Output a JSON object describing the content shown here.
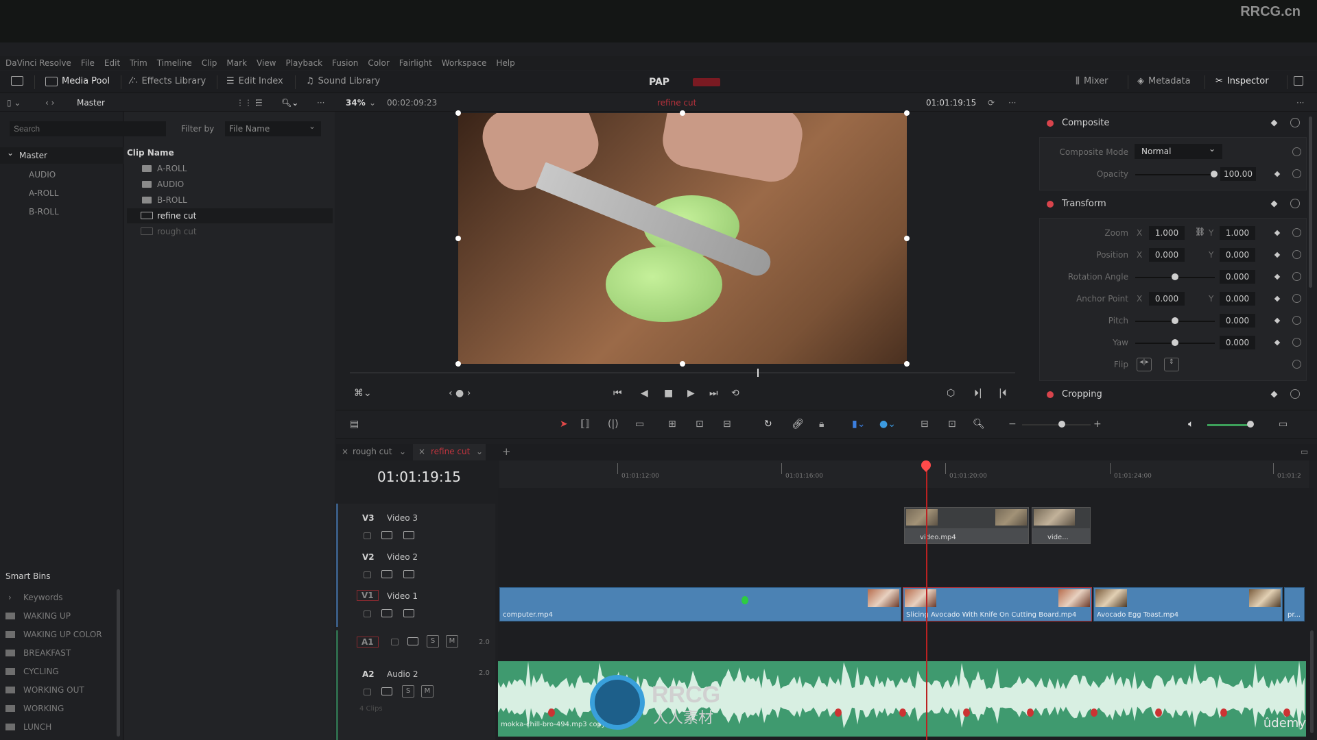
{
  "watermark": {
    "site": "RRCG.cn",
    "logo_text": "RRCG",
    "logo_sub": "人人素材",
    "brand": "ûdemy"
  },
  "menu": [
    "DaVinci Resolve",
    "File",
    "Edit",
    "Trim",
    "Timeline",
    "Clip",
    "Mark",
    "View",
    "Playback",
    "Fusion",
    "Color",
    "Fairlight",
    "Workspace",
    "Help"
  ],
  "modebar": {
    "left": [
      {
        "label": "Media Pool",
        "icon": "media-pool-icon"
      },
      {
        "label": "Effects Library",
        "icon": "effects-icon"
      },
      {
        "label": "Edit Index",
        "icon": "list-icon"
      },
      {
        "label": "Sound Library",
        "icon": "music-icon"
      }
    ],
    "project_title": "PAP",
    "right": [
      {
        "label": "Mixer",
        "icon": "mixer-icon"
      },
      {
        "label": "Metadata",
        "icon": "metadata-icon"
      },
      {
        "label": "Inspector",
        "icon": "inspector-icon"
      }
    ]
  },
  "viewer_bar": {
    "bin_path": "Master",
    "zoom": "34%",
    "duration": "00:02:09:23",
    "timeline_name": "refine cut",
    "timecode": "01:01:19:15"
  },
  "media_pool": {
    "search_placeholder": "Search",
    "filter_label": "Filter by",
    "filter_value": "File Name",
    "bins": {
      "master": "Master",
      "children": [
        "AUDIO",
        "A-ROLL",
        "B-ROLL"
      ]
    },
    "clip_header": "Clip Name",
    "clips": [
      {
        "name": "A-ROLL",
        "type": "folder"
      },
      {
        "name": "AUDIO",
        "type": "folder"
      },
      {
        "name": "B-ROLL",
        "type": "folder"
      },
      {
        "name": "refine cut",
        "type": "timeline",
        "selected": true
      },
      {
        "name": "rough cut",
        "type": "timeline"
      }
    ],
    "smart_bins_label": "Smart Bins",
    "smart_bins": [
      "Keywords",
      "WAKING UP",
      "WAKING UP COLOR",
      "BREAKFAST",
      "CYCLING",
      "WORKING OUT",
      "WORKING",
      "LUNCH"
    ]
  },
  "inspector": {
    "composite": {
      "title": "Composite",
      "mode_label": "Composite Mode",
      "mode_value": "Normal",
      "opacity_label": "Opacity",
      "opacity_value": "100.00"
    },
    "transform": {
      "title": "Transform",
      "zoom_label": "Zoom",
      "zoom_x": "1.000",
      "zoom_y": "1.000",
      "position_label": "Position",
      "position_x": "0.000",
      "position_y": "0.000",
      "rotation_label": "Rotation Angle",
      "rotation_value": "0.000",
      "anchor_label": "Anchor Point",
      "anchor_x": "0.000",
      "anchor_y": "0.000",
      "pitch_label": "Pitch",
      "pitch_value": "0.000",
      "yaw_label": "Yaw",
      "yaw_value": "0.000",
      "flip_label": "Flip",
      "x": "X",
      "y": "Y"
    },
    "cropping": {
      "title": "Cropping"
    }
  },
  "timeline": {
    "tabs": [
      {
        "label": "rough cut"
      },
      {
        "label": "refine cut",
        "active": true
      }
    ],
    "timecode": "01:01:19:15",
    "ruler": [
      "01:01:12:00",
      "01:01:16:00",
      "01:01:20:00",
      "01:01:24:00",
      "01:01:2"
    ],
    "tracks": {
      "v3": {
        "id": "V3",
        "name": "Video 3"
      },
      "v2": {
        "id": "V2",
        "name": "Video 2"
      },
      "v1": {
        "id": "V1",
        "name": "Video 1"
      },
      "a1": {
        "id": "A1",
        "channels": "2.0"
      },
      "a2": {
        "id": "A2",
        "name": "Audio 2",
        "channels": "2.0",
        "clips": "4 Clips"
      }
    },
    "v3_clips": [
      "video.mp4",
      "vide..."
    ],
    "v1_clips": [
      "computer.mp4",
      "Slicing Avocado With Knife On Cutting Board.mp4",
      "Avocado Egg Toast.mp4",
      "pr..."
    ],
    "audio_clip": "mokka-chill-bro-494.mp3 copy",
    "solo": "S",
    "mute": "M"
  }
}
